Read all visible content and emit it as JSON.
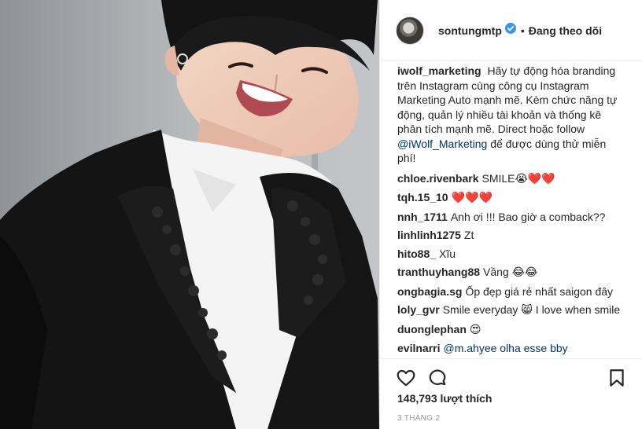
{
  "post": {
    "author": "sontungmtp",
    "follow_separator": "•",
    "follow_label": "Đang theo dõi"
  },
  "caption": {
    "user": "iwolf_marketing",
    "text": "Hãy tự động hóa branding trên Instagram cùng công cụ Instagram Marketing Auto mạnh mẽ. Kèm chức năng tự động, quản lý nhiều tài khoản và thống kê phân tích mạnh mẽ. Direct hoặc follow",
    "mention": "@iWolf_Marketing",
    "text_after": "để được dùng thử miễn phí!"
  },
  "comments": [
    {
      "user": "chloe.rivenbark",
      "text": "SMILE",
      "emoji": "😭",
      "hearts": "❤️❤️"
    },
    {
      "user": "tqh.15_10",
      "text": "",
      "emoji": "",
      "hearts": "❤️❤️❤️"
    },
    {
      "user": "nnh_1711",
      "text": "Anh ơi !!! Bao giờ a comback??",
      "emoji": "",
      "hearts": ""
    },
    {
      "user": "linhlinh1275",
      "text": "Zt",
      "emoji": "",
      "hearts": ""
    },
    {
      "user": "hito88_",
      "text": "Xĩu",
      "emoji": "",
      "hearts": ""
    },
    {
      "user": "tranthuyhang88",
      "text": "Vầng",
      "emoji": "😂😂",
      "hearts": ""
    },
    {
      "user": "ongbagia.sg",
      "text": "Ốp đẹp giá rẻ nhất saigon đây",
      "emoji": "",
      "hearts": ""
    },
    {
      "user": "loly_gvr",
      "text": "Smile everyday",
      "emoji": "😸",
      "text2": "I love when smile",
      "hearts": ""
    },
    {
      "user": "duonglephan",
      "text": "",
      "emoji": "😍",
      "hearts": ""
    },
    {
      "user": "evilnarri",
      "text": "@m.ahyee olha esse bby",
      "emoji": "",
      "hearts": ""
    }
  ],
  "stats": {
    "likes": "148,793 lượt thích",
    "date": "3 THÁNG 2"
  },
  "icons": {
    "like": "heart-outline-icon",
    "comment": "speech-bubble-icon",
    "save": "bookmark-icon",
    "verified": "verified-badge-icon"
  },
  "colors": {
    "verified": "#3897f0",
    "mention": "#003569",
    "muted": "#999999",
    "heart": "#e0245e"
  }
}
